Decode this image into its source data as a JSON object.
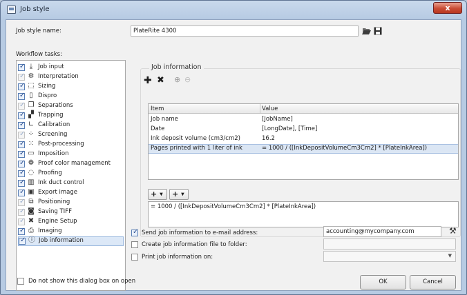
{
  "window": {
    "title": "Job style",
    "close_label": "x",
    "icon": "monitor-icon"
  },
  "job_style_name": {
    "label": "Job style name:",
    "value": "PlateRite 4300",
    "open_icon": "folder-open-icon",
    "save_icon": "save-icon"
  },
  "workflow": {
    "label": "Workflow tasks:",
    "tasks": [
      {
        "label": "Job input",
        "checked": true,
        "enabled": true,
        "icon": "import-icon"
      },
      {
        "label": "Interpretation",
        "checked": true,
        "enabled": false,
        "icon": "interpretation-icon"
      },
      {
        "label": "Sizing",
        "checked": true,
        "enabled": true,
        "icon": "sizing-icon"
      },
      {
        "label": "Dispro",
        "checked": true,
        "enabled": true,
        "icon": "dispro-icon"
      },
      {
        "label": "Separations",
        "checked": true,
        "enabled": false,
        "icon": "separations-icon"
      },
      {
        "label": "Trapping",
        "checked": true,
        "enabled": true,
        "icon": "trapping-icon"
      },
      {
        "label": "Calibration",
        "checked": true,
        "enabled": true,
        "icon": "calibration-icon"
      },
      {
        "label": "Screening",
        "checked": true,
        "enabled": false,
        "icon": "screening-icon"
      },
      {
        "label": "Post-processing",
        "checked": true,
        "enabled": true,
        "icon": "post-processing-icon"
      },
      {
        "label": "Imposition",
        "checked": true,
        "enabled": true,
        "icon": "imposition-icon"
      },
      {
        "label": "Proof color management",
        "checked": true,
        "enabled": true,
        "icon": "color-management-icon"
      },
      {
        "label": "Proofing",
        "checked": true,
        "enabled": true,
        "icon": "proofing-icon"
      },
      {
        "label": "Ink duct control",
        "checked": true,
        "enabled": true,
        "icon": "ink-duct-icon"
      },
      {
        "label": "Export image",
        "checked": true,
        "enabled": true,
        "icon": "export-image-icon"
      },
      {
        "label": "Positioning",
        "checked": true,
        "enabled": false,
        "icon": "positioning-icon"
      },
      {
        "label": "Saving TIFF",
        "checked": true,
        "enabled": false,
        "icon": "tiff-icon"
      },
      {
        "label": "Engine Setup",
        "checked": true,
        "enabled": false,
        "icon": "engine-setup-icon"
      },
      {
        "label": "Imaging",
        "checked": true,
        "enabled": true,
        "icon": "imaging-icon"
      },
      {
        "label": "Job information",
        "checked": true,
        "enabled": true,
        "icon": "info-icon",
        "selected": true
      }
    ]
  },
  "job_info": {
    "group_title": "Job information",
    "toolbar": {
      "add_icon": "plus-icon",
      "delete_icon": "delete-icon",
      "up_icon": "move-up-icon",
      "down_icon": "move-down-icon"
    },
    "columns": [
      "Item",
      "Value"
    ],
    "rows": [
      {
        "item": "Job name",
        "value": "[JobName]"
      },
      {
        "item": "Date",
        "value": "[LongDate], [Time]"
      },
      {
        "item": "Ink deposit volume (cm3/cm2)",
        "value": "16.2"
      },
      {
        "item": "Pages printed with 1 liter of ink",
        "value": "= 1000 / ([InkDepositVolumeCm3Cm2] * [PlateInkArea])",
        "selected": true
      }
    ],
    "insert_buttons": [
      "+",
      "+"
    ],
    "expression": "= 1000 / ([InkDepositVolumeCm3Cm2] * [PlateInkArea])"
  },
  "options": {
    "email": {
      "label": "Send job information to e-mail address:",
      "checked": true,
      "value": "accounting@mycompany.com",
      "settings_icon": "tools-icon"
    },
    "file": {
      "label": "Create job information file to folder:",
      "checked": false,
      "value": ""
    },
    "print": {
      "label": "Print job information on:",
      "checked": false,
      "value": ""
    }
  },
  "footer": {
    "dont_show_label": "Do not show this dialog box on open",
    "ok_label": "OK",
    "cancel_label": "Cancel"
  },
  "colors": {
    "selection": "#dce8f7",
    "title_bar": "#b7cbe3",
    "close_button": "#c94d36"
  }
}
